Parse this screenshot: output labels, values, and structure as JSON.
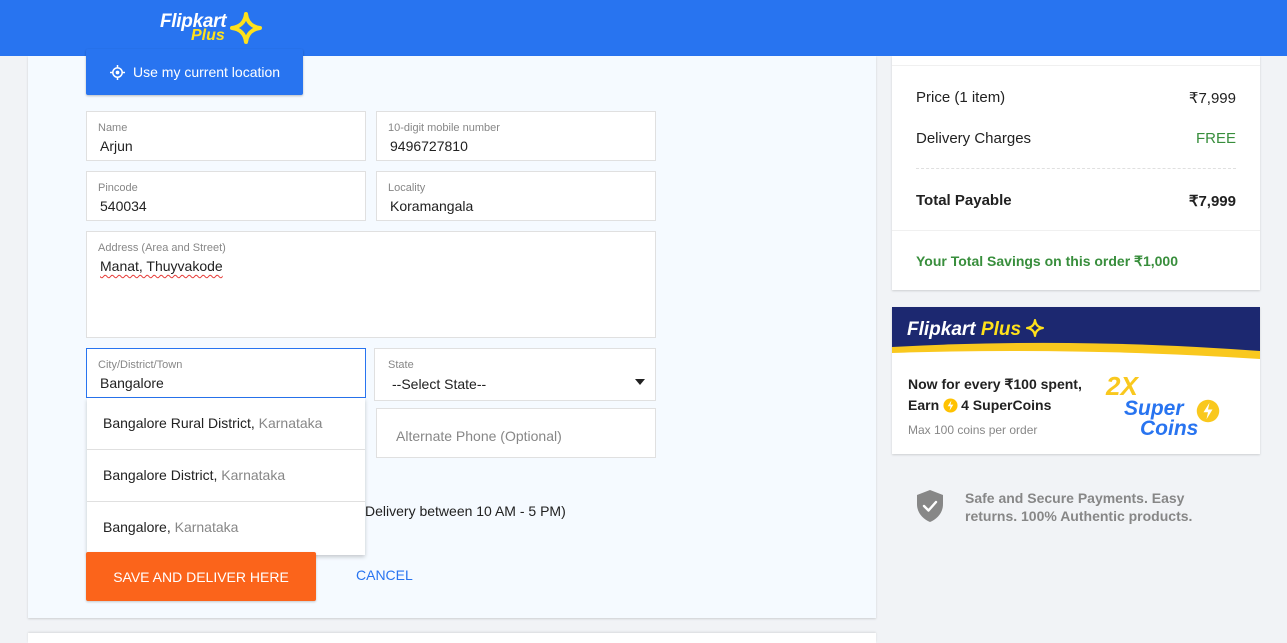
{
  "header": {
    "brand_name": "Flipkart",
    "brand_tier": "Plus"
  },
  "form": {
    "location_button": "Use my current location",
    "name": {
      "label": "Name",
      "value": "Arjun"
    },
    "mobile": {
      "label": "10-digit mobile number",
      "value": "9496727810"
    },
    "pincode": {
      "label": "Pincode",
      "value": "540034"
    },
    "locality": {
      "label": "Locality",
      "value": "Koramangala"
    },
    "address": {
      "label": "Address (Area and Street)",
      "value": "Manat, Thuyvakode"
    },
    "city": {
      "label": "City/District/Town",
      "value": "Bangalore"
    },
    "state": {
      "label": "State",
      "value": "--Select State--"
    },
    "alternate_phone": {
      "placeholder": "Alternate Phone (Optional)"
    },
    "delivery_option_text": "Delivery between 10 AM - 5 PM)",
    "save_button": "SAVE AND DELIVER HERE",
    "cancel_button": "CANCEL"
  },
  "city_suggestions": [
    {
      "city": "Bangalore Rural District,",
      "state": "Karnataka"
    },
    {
      "city": "Bangalore District,",
      "state": "Karnataka"
    },
    {
      "city": "Bangalore,",
      "state": "Karnataka"
    }
  ],
  "price_details": {
    "price_label": "Price (1 item)",
    "price_value": "₹7,999",
    "delivery_label": "Delivery Charges",
    "delivery_value": "FREE",
    "total_label": "Total Payable",
    "total_value": "₹7,999",
    "savings_text": "Your Total Savings on this order ₹1,000"
  },
  "plus_banner": {
    "brand_name": "Flipkart",
    "brand_tier": "Plus",
    "line1": "Now for every ₹100 spent,",
    "line2_prefix": "Earn",
    "line2_suffix": "4 SuperCoins",
    "line3": "Max 100 coins per order",
    "multiplier": "2X",
    "coins_word1": "Super",
    "coins_word2": "Coins"
  },
  "secure_note": "Safe and Secure Payments. Easy returns. 100% Authentic products.",
  "colors": {
    "header_blue": "#2874f0",
    "save_orange": "#fb641b",
    "free_green": "#388e3c",
    "plus_yellow": "#ffe11b"
  }
}
